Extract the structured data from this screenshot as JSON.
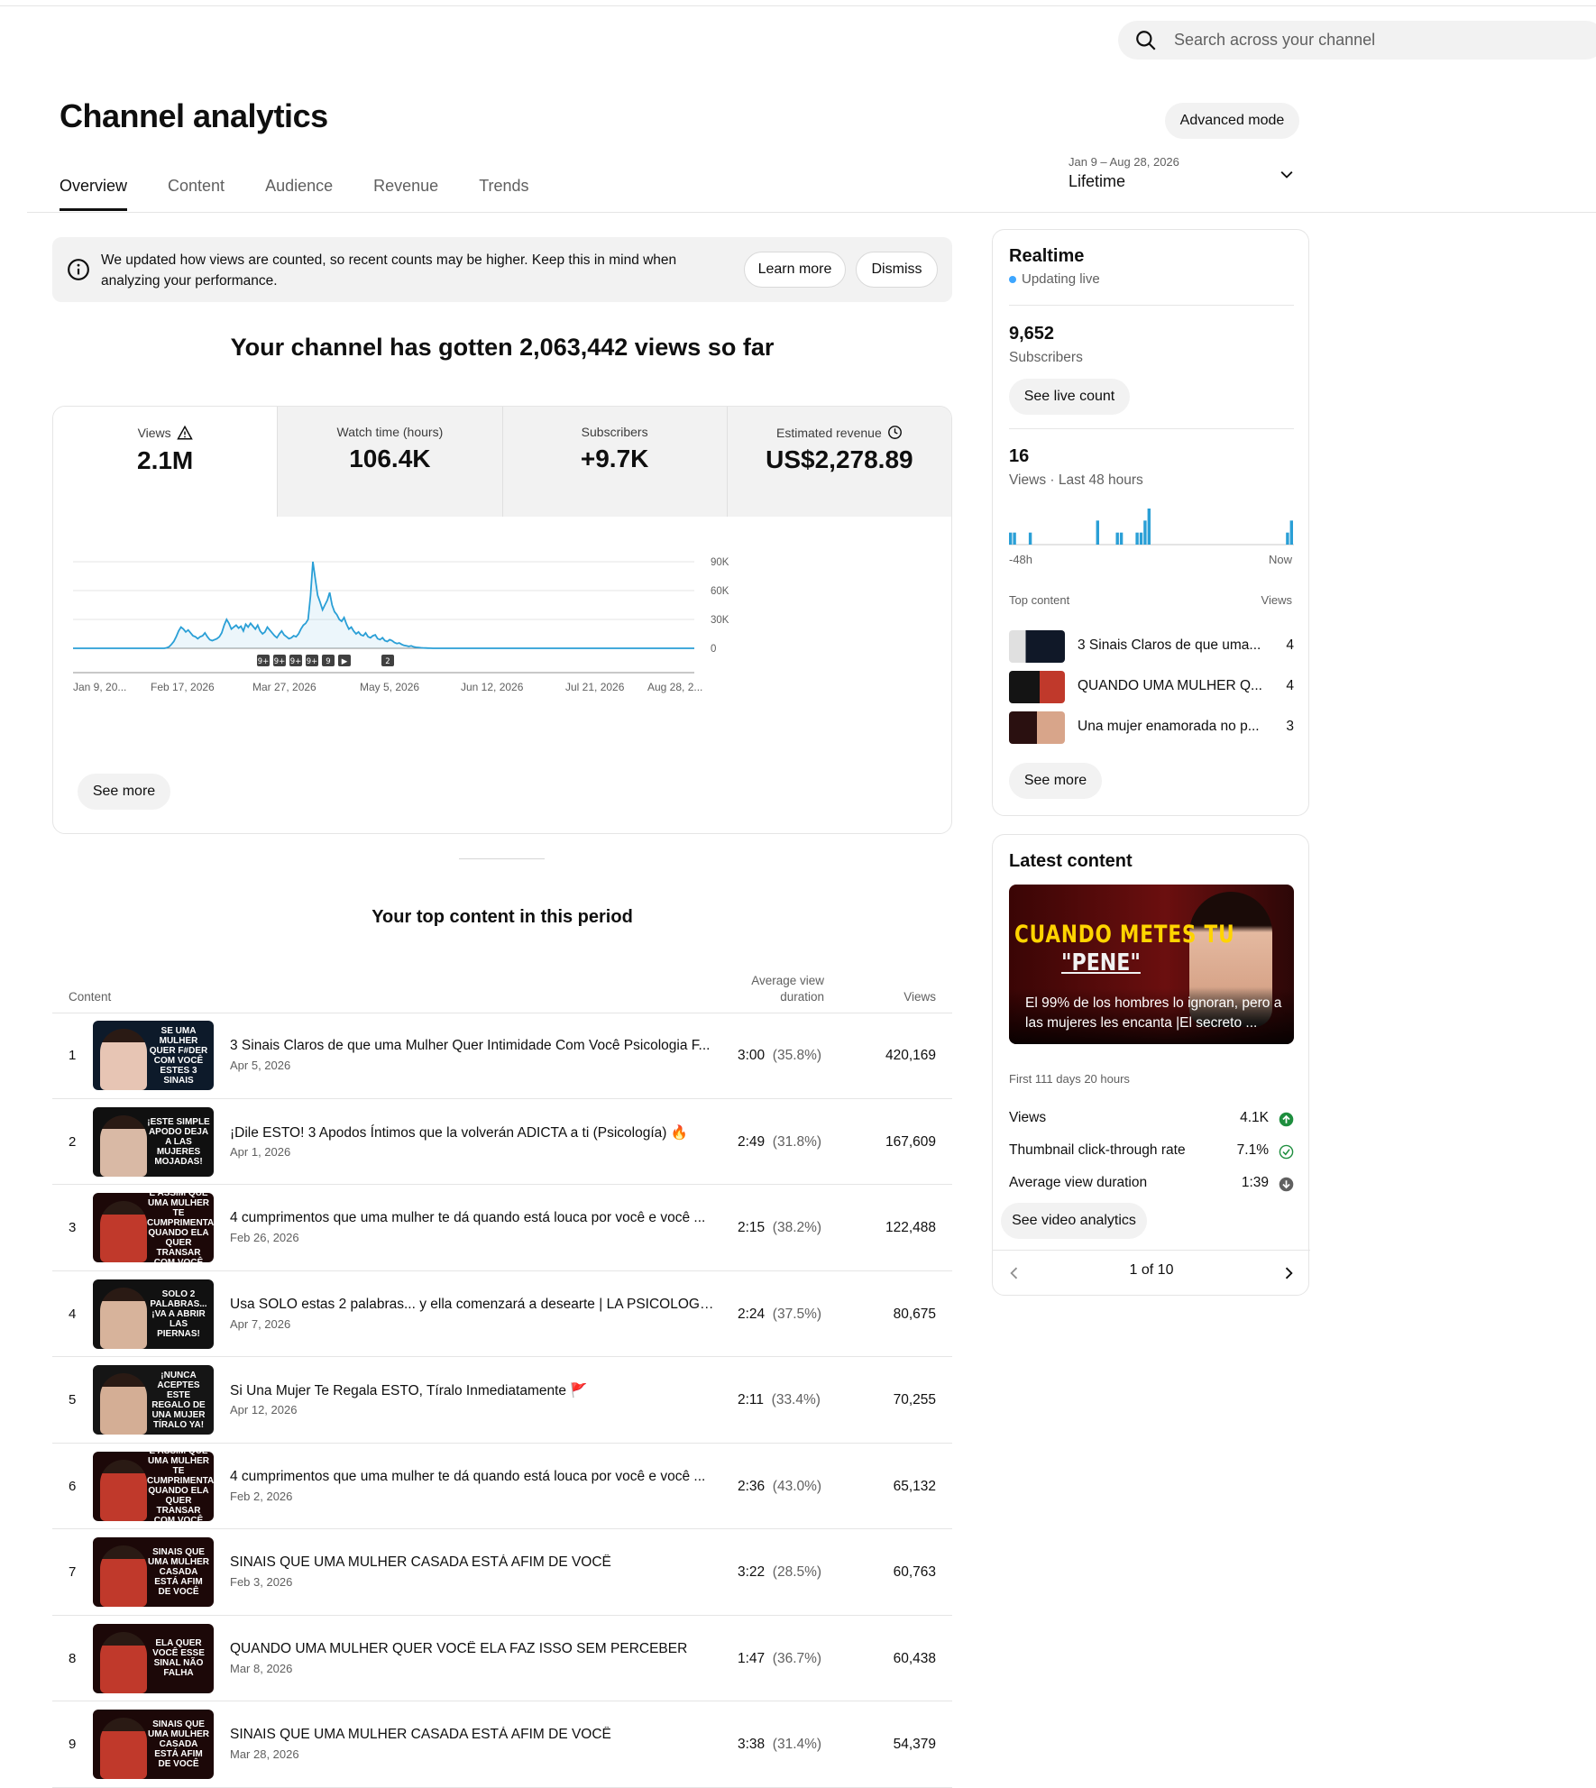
{
  "search": {
    "placeholder": "Search across your channel"
  },
  "header": {
    "title": "Channel analytics",
    "advanced_label": "Advanced mode",
    "date_range": "Jan 9 – Aug 28, 2026",
    "period": "Lifetime"
  },
  "tabs": [
    "Overview",
    "Content",
    "Audience",
    "Revenue",
    "Trends"
  ],
  "notice": {
    "text": "We updated how views are counted, so recent counts may be higher. Keep this in mind when analyzing your performance.",
    "learn_more": "Learn more",
    "dismiss": "Dismiss"
  },
  "headline": "Your channel has gotten 2,063,442 views so far",
  "metrics": [
    {
      "label": "Views",
      "value": "2.1M"
    },
    {
      "label": "Watch time (hours)",
      "value": "106.4K"
    },
    {
      "label": "Subscribers",
      "value": "+9.7K"
    },
    {
      "label": "Estimated revenue",
      "value": "US$2,278.89"
    }
  ],
  "chart_data": {
    "type": "area",
    "series": [
      {
        "values": [
          0,
          0,
          0,
          0,
          0,
          0,
          0,
          0,
          0,
          0,
          0,
          0,
          0,
          0,
          0,
          0,
          0,
          0,
          0,
          0,
          0,
          0,
          0,
          0,
          0,
          0,
          0,
          0,
          0,
          0,
          0,
          0,
          0,
          0,
          0,
          0,
          0,
          0,
          0,
          500,
          1500,
          4000,
          7000,
          12000,
          18000,
          22000,
          20000,
          17000,
          19000,
          16000,
          13000,
          12000,
          10000,
          12000,
          13000,
          16000,
          12000,
          9000,
          8000,
          9000,
          10000,
          12000,
          16000,
          24000,
          30000,
          26000,
          20000,
          22000,
          24000,
          21000,
          23000,
          18000,
          25000,
          22000,
          26000,
          23000,
          20000,
          24000,
          18000,
          15000,
          17000,
          22000,
          19000,
          16000,
          13000,
          11000,
          15000,
          18000,
          14000,
          12000,
          10000,
          11000,
          13000,
          12000,
          15000,
          20000,
          24000,
          26000,
          30000,
          55000,
          90000,
          72000,
          55000,
          48000,
          40000,
          45000,
          50000,
          58000,
          45000,
          38000,
          35000,
          30000,
          28000,
          32000,
          25000,
          20000,
          22000,
          18000,
          15000,
          17000,
          14000,
          13000,
          16000,
          12000,
          11000,
          13000,
          14000,
          10000,
          9000,
          11000,
          8000,
          7000,
          9000,
          8000,
          6000,
          5000,
          5500,
          4000,
          3000,
          2500,
          2000,
          2500,
          1500,
          1000,
          800,
          600,
          400,
          300,
          200,
          100,
          0,
          0,
          0,
          0,
          0,
          0,
          0,
          0,
          0,
          0,
          0,
          0,
          0,
          0,
          0,
          0,
          0,
          0,
          0,
          0,
          0,
          0,
          0,
          0,
          0,
          0,
          0,
          0,
          0,
          0,
          0,
          0,
          0,
          0,
          0,
          0,
          0,
          0,
          0,
          0,
          0,
          0,
          0,
          0,
          0,
          0,
          0,
          0,
          0,
          0,
          0,
          0,
          0,
          0,
          0,
          0,
          0,
          0,
          0,
          0,
          0,
          0,
          0,
          0,
          0,
          0,
          0,
          0,
          0,
          0,
          0,
          0,
          0,
          0,
          0,
          0,
          0,
          0,
          0,
          0,
          0,
          0,
          0,
          0,
          0,
          0,
          0,
          0,
          0,
          0,
          0,
          0,
          0,
          0,
          0,
          0,
          0,
          0,
          0,
          0,
          0,
          0,
          0,
          0,
          0,
          0,
          0,
          0,
          0,
          0
        ]
      }
    ],
    "x_start": "Jan 9, 2026",
    "x_end": "Aug 28, 2026",
    "x_tick_labels": [
      "Jan 9, 20...",
      "Feb 17, 2026",
      "Mar 27, 2026",
      "May 5, 2026",
      "Jun 12, 2026",
      "Jul 21, 2026",
      "Aug 28, 2..."
    ],
    "y_ticks": [
      "90K",
      "60K",
      "30K",
      "0"
    ],
    "ylim": [
      0,
      90000
    ],
    "markers": [
      "9+",
      "9+",
      "9+",
      "9+",
      "9",
      "▶",
      "2"
    ],
    "grid": true
  },
  "see_more": "See more",
  "top_content": {
    "heading": "Your top content in this period",
    "col_content": "Content",
    "col_avd_1": "Average view",
    "col_avd_2": "duration",
    "col_views": "Views",
    "rows": [
      {
        "n": "1",
        "title": "3 Sinais Claros de que uma Mulher Quer Intimidade Com Você Psicologia F...",
        "date": "Apr 5, 2026",
        "dur": "3:00",
        "pct": "(35.8%)",
        "views": "420,169",
        "thumb": "SE UMA MULHER QUER F#DER COM VOCÊ ESTES 3 SINAIS",
        "bg": "#0d1a2a",
        "face": "#e7c5b4"
      },
      {
        "n": "2",
        "title": "¡Dile ESTO! 3 Apodos Íntimos que la volverán ADICTA a ti (Psicología) 🔥",
        "date": "Apr 1, 2026",
        "dur": "2:49",
        "pct": "(31.8%)",
        "views": "167,609",
        "thumb": "¡ESTE SIMPLE APODO DEJA A LAS MUJERES MOJADAS!",
        "bg": "#101010",
        "face": "#d9b9a5"
      },
      {
        "n": "3",
        "title": "4 cumprimentos que uma mulher te dá quando está louca por você e você ...",
        "date": "Feb 26, 2026",
        "dur": "2:15",
        "pct": "(38.2%)",
        "views": "122,488",
        "thumb": "É ASSIM QUE UMA MULHER TE CUMPRIMENTA QUANDO ELA QUER TRANSAR COM VOCÊ",
        "bg": "#1c0808",
        "face": "#c0392b"
      },
      {
        "n": "4",
        "title": "Usa SOLO estas 2 palabras... y ella comenzará a desearte | LA PSICOLOGÍA...",
        "date": "Apr 7, 2026",
        "dur": "2:24",
        "pct": "(37.5%)",
        "views": "80,675",
        "thumb": "Solo 2 PALABRAS... ¡VA A ABRIR LAS PIERNAS!",
        "bg": "#111111",
        "face": "#d7b39b"
      },
      {
        "n": "5",
        "title": "Si Una Mujer Te Regala ESTO, Tíralo Inmediatamente 🚩",
        "date": "Apr 12, 2026",
        "dur": "2:11",
        "pct": "(33.4%)",
        "views": "70,255",
        "thumb": "¡NUNCA ACEPTES ESTE REGALO DE UNA MUJER TÍRALO YA!",
        "bg": "#151515",
        "face": "#d4ae95"
      },
      {
        "n": "6",
        "title": "4 cumprimentos que uma mulher te dá quando está louca por você e você ...",
        "date": "Feb 2, 2026",
        "dur": "2:36",
        "pct": "(43.0%)",
        "views": "65,132",
        "thumb": "É ASSIM QUE UMA MULHER TE CUMPRIMENTA QUANDO ELA QUER TRANSAR COM VOCÊ",
        "bg": "#1c0808",
        "face": "#c0392b"
      },
      {
        "n": "7",
        "title": "SINAIS QUE UMA MULHER CASADA ESTÁ AFIM DE VOCÊ",
        "date": "Feb 3, 2026",
        "dur": "3:22",
        "pct": "(28.5%)",
        "views": "60,763",
        "thumb": "SINAIS QUE UMA MULHER CASADA ESTÁ AFIM DE VOCÊ",
        "bg": "#1c0808",
        "face": "#c0392b"
      },
      {
        "n": "8",
        "title": "QUANDO UMA MULHER QUER VOCÊ ELA FAZ ISSO SEM PERCEBER",
        "date": "Mar 8, 2026",
        "dur": "1:47",
        "pct": "(36.7%)",
        "views": "60,438",
        "thumb": "ELA QUER VOCÊ ESSE SINAL NÃO FALHA",
        "bg": "#1c0808",
        "face": "#c0392b"
      },
      {
        "n": "9",
        "title": "SINAIS QUE UMA MULHER CASADA ESTÁ AFIM DE VOCÊ",
        "date": "Mar 28, 2026",
        "dur": "3:38",
        "pct": "(31.4%)",
        "views": "54,379",
        "thumb": "SINAIS QUE UMA MULHER CASADA ESTÁ AFIM DE VOCÊ",
        "bg": "#1c0808",
        "face": "#c0392b"
      }
    ]
  },
  "realtime": {
    "title": "Realtime",
    "live": "Updating live",
    "subs_value": "9,652",
    "subs_label": "Subscribers",
    "see_live": "See live count",
    "views_value": "16",
    "views_label": "Views · Last 48 hours",
    "bars": [
      1,
      1,
      0,
      0,
      0,
      1,
      0,
      0,
      0,
      0,
      0,
      0,
      0,
      0,
      0,
      0,
      0,
      0,
      0,
      0,
      0,
      0,
      2,
      0,
      0,
      0,
      0,
      1,
      1,
      0,
      0,
      0,
      1,
      1,
      2,
      3,
      0,
      0,
      0,
      0,
      0,
      0,
      0,
      0,
      0,
      0,
      0,
      0,
      0,
      0,
      0,
      0,
      0,
      0,
      0,
      0,
      0,
      0,
      0,
      0,
      0,
      0,
      0,
      0,
      0,
      0,
      0,
      0,
      0,
      0,
      1,
      2
    ],
    "bars_max": 3,
    "x_left": "-48h",
    "x_right": "Now",
    "top_label": "Top content",
    "views_col": "Views",
    "items": [
      {
        "title": "3 Sinais Claros de que uma...",
        "views": "4"
      },
      {
        "title": "QUANDO UMA MULHER Q...",
        "views": "4"
      },
      {
        "title": "Una mujer enamorada no p...",
        "views": "3"
      }
    ],
    "see_more": "See more"
  },
  "latest": {
    "title": "Latest content",
    "thumb_line1": "CUANDO METES TU",
    "thumb_line2": "\"PENE\"",
    "caption": "El 99% de los hombres lo ignoran, pero a las mujeres les encanta |El secreto ...",
    "period": "First 111 days 20 hours",
    "stats": [
      {
        "label": "Views",
        "value": "4.1K",
        "icon": "arrow-up-circle-icon"
      },
      {
        "label": "Thumbnail click-through rate",
        "value": "7.1%",
        "icon": "check-circle-icon"
      },
      {
        "label": "Average view duration",
        "value": "1:39",
        "icon": "arrow-down-circle-icon"
      }
    ],
    "see_video": "See video analytics",
    "pager": "1 of 10"
  },
  "colors": {
    "accent": "#3ea6ff",
    "line": "#2a9fd6",
    "up": "#1e8e3e",
    "down": "#606060"
  }
}
